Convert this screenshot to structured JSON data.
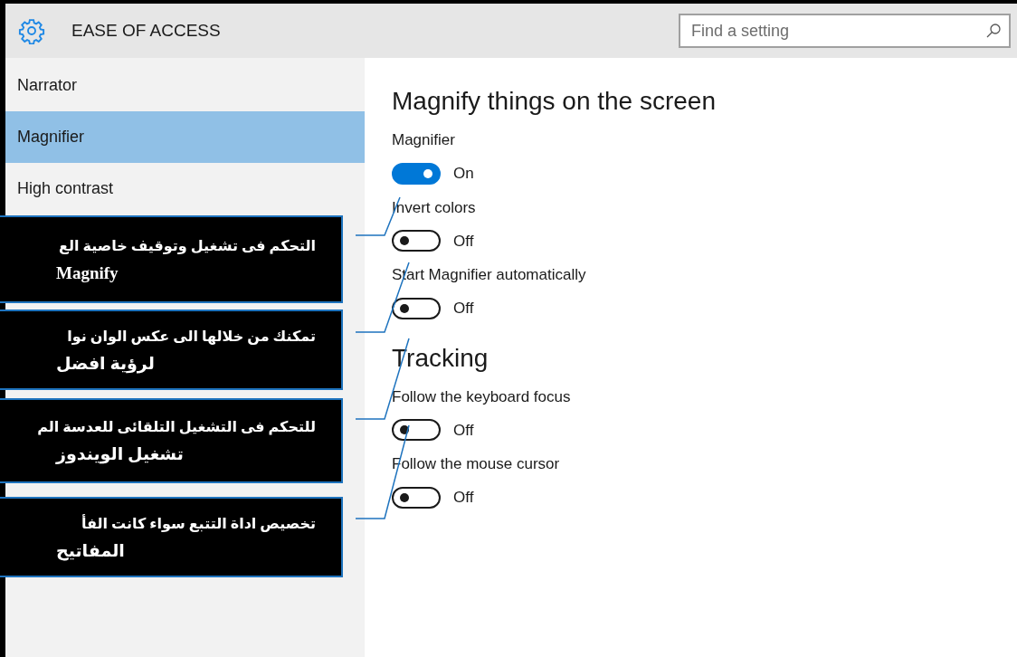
{
  "header": {
    "title": "EASE OF ACCESS",
    "search": {
      "placeholder": "Find a setting"
    }
  },
  "sidebar": {
    "items": [
      {
        "label": "Narrator",
        "selected": false
      },
      {
        "label": "Magnifier",
        "selected": true
      },
      {
        "label": "High contrast",
        "selected": false
      }
    ]
  },
  "content": {
    "sections": [
      {
        "heading": "Magnify things on the screen",
        "settings": [
          {
            "label": "Magnifier",
            "on": true,
            "state_text": "On"
          },
          {
            "label": "Invert colors",
            "on": false,
            "state_text": "Off"
          },
          {
            "label": "Start Magnifier automatically",
            "on": false,
            "state_text": "Off"
          }
        ]
      },
      {
        "heading": "Tracking",
        "settings": [
          {
            "label": "Follow the keyboard focus",
            "on": false,
            "state_text": "Off"
          },
          {
            "label": "Follow the mouse cursor",
            "on": false,
            "state_text": "Off"
          }
        ]
      }
    ]
  },
  "callouts": [
    {
      "lines": [
        "التحكم فى تشغيل وتوقيف خاصية الع",
        "Magnify"
      ]
    },
    {
      "lines": [
        "تمكنك من خلالها الى عكس الوان نوا",
        "لرؤية افضل"
      ]
    },
    {
      "lines": [
        "للتحكم فى التشغيل التلقائى للعدسة الم",
        "تشغيل الويندوز"
      ]
    },
    {
      "lines": [
        "تخصيص اداة التتبع سواء كانت الفأ",
        "المفاتيح"
      ]
    }
  ]
}
